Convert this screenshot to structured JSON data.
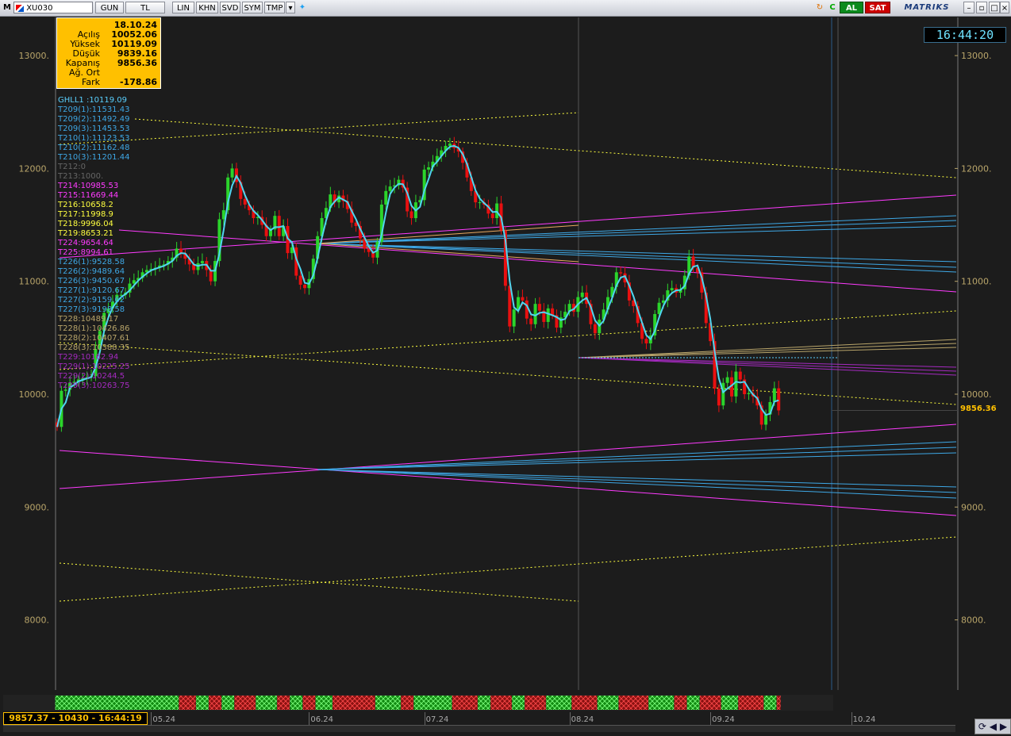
{
  "toolbar": {
    "m_label": "M",
    "symbol": "XU030",
    "buttons": [
      "GUN",
      "TL",
      "LIN",
      "KHN",
      "SVD",
      "SYM",
      "TMP"
    ],
    "al_label": "AL",
    "sat_label": "SAT",
    "brand": "MATRIKS"
  },
  "clock": "16:44:20",
  "infobox": {
    "date": "18.10.24",
    "rows": [
      {
        "label": "Açılış",
        "value": "10052.06"
      },
      {
        "label": "Yüksek",
        "value": "10119.09"
      },
      {
        "label": "Düşük",
        "value": "9839.16"
      },
      {
        "label": "Kapanış",
        "value": "9856.36"
      },
      {
        "label": "Ağ. Ort",
        "value": ""
      },
      {
        "label": "Fark",
        "value": "-178.86"
      }
    ]
  },
  "legend": [
    {
      "text": "GHLL1      :10119.09",
      "color": "#5ad1ff"
    },
    {
      "text": "T209(1):11531.43",
      "color": "#3ea8e6"
    },
    {
      "text": "T209(2):11492.49",
      "color": "#3ea8e6"
    },
    {
      "text": "T209(3):11453.53",
      "color": "#3ea8e6"
    },
    {
      "text": "T210(1):11123.53",
      "color": "#3ea8e6"
    },
    {
      "text": "T210(2):11162.48",
      "color": "#3ea8e6"
    },
    {
      "text": "T210(3):11201.44",
      "color": "#3ea8e6"
    },
    {
      "text": "T212:0",
      "color": "#666666"
    },
    {
      "text": "T213:1000.",
      "color": "#666666"
    },
    {
      "text": "T214:10985.53",
      "color": "#ff3bff"
    },
    {
      "text": "T215:11669.44",
      "color": "#ff3bff"
    },
    {
      "text": "T216:10658.2",
      "color": "#ffff40"
    },
    {
      "text": "T217:11998.9",
      "color": "#ffff40"
    },
    {
      "text": "T218:9996.04",
      "color": "#ffff40"
    },
    {
      "text": "T219:8653.21",
      "color": "#ffff40"
    },
    {
      "text": "T224:9654.64",
      "color": "#ff3bff"
    },
    {
      "text": "T225:8994.61",
      "color": "#ff3bff"
    },
    {
      "text": "T226(1):9528.58",
      "color": "#3ea8e6"
    },
    {
      "text": "T226(2):9489.64",
      "color": "#3ea8e6"
    },
    {
      "text": "T226(3):9450.67",
      "color": "#3ea8e6"
    },
    {
      "text": "T227(1):9120.67",
      "color": "#3ea8e6"
    },
    {
      "text": "T227(2):9159.62",
      "color": "#3ea8e6"
    },
    {
      "text": "T227(3):9198.58",
      "color": "#3ea8e6"
    },
    {
      "text": "T228:10489.17",
      "color": "#b9a56a"
    },
    {
      "text": "T228(1):10426.86",
      "color": "#b9a56a"
    },
    {
      "text": "T228(2):10407.61",
      "color": "#b9a56a"
    },
    {
      "text": "T228(3):10388.35",
      "color": "#b9a56a"
    },
    {
      "text": "T229:10162.94",
      "color": "#a52ac0"
    },
    {
      "text": "T229(1):10225.25",
      "color": "#a52ac0"
    },
    {
      "text": "T229(2):10244.5",
      "color": "#a52ac0"
    },
    {
      "text": "T229(3):10263.75",
      "color": "#a52ac0"
    }
  ],
  "last_price_label": "9856.36",
  "status_bar": "9857.37 - 10430 - 16:44:19",
  "colors": {
    "background": "#1c1c1c",
    "axis_text": "#b9a56a",
    "candle_up": "#2bd42b",
    "candle_down": "#e81010",
    "indicator_line": "#4fd6f0",
    "accent": "#ffc000"
  },
  "chart_data": {
    "type": "candlestick",
    "ylim": [
      7650,
      13250
    ],
    "y_ticks": [
      8000,
      9000,
      10000,
      11000,
      12000,
      13000
    ],
    "y_tick_labels": [
      "8000.",
      "9000.",
      "10000.",
      "11000.",
      "12000.",
      "13000."
    ],
    "x_ticks": [
      "05.24",
      "06.24",
      "07.24",
      "08.24",
      "09.24",
      "10.24"
    ],
    "x_tick_index": [
      22,
      59,
      86,
      120,
      153,
      186
    ],
    "closes": [
      9710,
      10030,
      10040,
      10100,
      10110,
      10130,
      10140,
      10150,
      10160,
      10400,
      10560,
      10720,
      10760,
      10820,
      10880,
      10880,
      10900,
      10980,
      11010,
      11030,
      11080,
      11100,
      11110,
      11120,
      11140,
      11150,
      11180,
      11210,
      11290,
      11250,
      11200,
      11150,
      11100,
      11160,
      11180,
      11100,
      11000,
      11180,
      11550,
      11630,
      11920,
      12000,
      11880,
      11730,
      11680,
      11630,
      11560,
      11570,
      11500,
      11400,
      11460,
      11580,
      11400,
      11490,
      11250,
      11300,
      11050,
      10970,
      10940,
      11020,
      11200,
      11400,
      11560,
      11650,
      11770,
      11700,
      11760,
      11710,
      11640,
      11520,
      11490,
      11380,
      11290,
      11260,
      11210,
      11350,
      11680,
      11800,
      11840,
      11850,
      11900,
      11830,
      11620,
      11560,
      11700,
      11720,
      11990,
      12010,
      12060,
      12110,
      12160,
      12200,
      12220,
      12180,
      12150,
      12050,
      11920,
      11800,
      11700,
      11700,
      11680,
      11600,
      11560,
      11690,
      11450,
      10960,
      10600,
      10750,
      10860,
      10830,
      10670,
      10620,
      10800,
      10740,
      10640,
      10760,
      10700,
      10590,
      10680,
      10730,
      10800,
      10730,
      10860,
      10900,
      10800,
      10620,
      10540,
      10660,
      10750,
      10860,
      10950,
      11080,
      11070,
      10990,
      10830,
      10780,
      10630,
      10490,
      10450,
      10520,
      10710,
      10810,
      10830,
      10920,
      10940,
      10900,
      10930,
      11050,
      11220,
      11120,
      11080,
      10900,
      10630,
      10470,
      10050,
      9900,
      10100,
      10150,
      9980,
      10200,
      10130,
      10000,
      10010,
      9980,
      9900,
      9730,
      9820,
      9930,
      10052,
      9856
    ],
    "open_close_note": "daily candles; colors follow close vs open",
    "last_bar": {
      "date": "18.10.24",
      "open": 10052.06,
      "high": 10119.09,
      "low": 9839.16,
      "close": 9856.36,
      "change": -178.86
    }
  }
}
